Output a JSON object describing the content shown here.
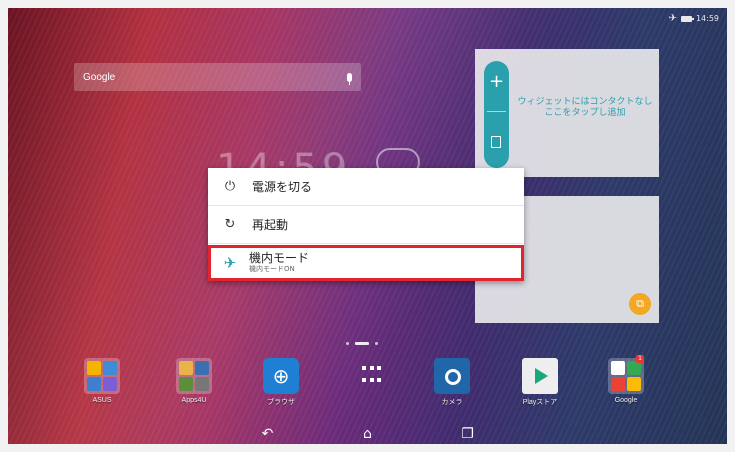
{
  "status_bar": {
    "airplane_icon": "airplane-icon",
    "battery_icon": "battery-icon",
    "time": "14:59"
  },
  "google_search": {
    "logo_text": "Google",
    "mic_icon": "mic-icon"
  },
  "clock_background_text": "14:59",
  "contact_widget": {
    "add_icon": "+",
    "hint_text": "ウィジェットにはコンタクトなし ここをタップし追加"
  },
  "power_menu": {
    "items": [
      {
        "icon": "power-icon",
        "glyph": "⏻",
        "label": "電源を切る"
      },
      {
        "icon": "restart-icon",
        "glyph": "↻",
        "label": "再起動"
      },
      {
        "icon": "airplane-icon",
        "glyph": "✈",
        "label": "機内モード",
        "sublabel": "機内モードON",
        "highlighted": true
      }
    ]
  },
  "dock": [
    {
      "label": "ASUS",
      "icon": "asus-folder-icon"
    },
    {
      "label": "Apps4U",
      "icon": "apps4u-folder-icon"
    },
    {
      "label": "ブラウザ",
      "icon": "browser-icon"
    },
    {
      "label": "",
      "icon": "all-apps-icon"
    },
    {
      "label": "カメラ",
      "icon": "camera-icon"
    },
    {
      "label": "Playストア",
      "icon": "play-store-icon"
    },
    {
      "label": "Google",
      "icon": "google-folder-icon",
      "badge": "1"
    }
  ],
  "nav_bar": {
    "back_icon": "back-icon",
    "home_icon": "home-icon",
    "recents_icon": "recents-icon"
  },
  "colors": {
    "accent": "#2aa0ad",
    "highlight_border": "#e02430",
    "memo_button": "#f2a823"
  }
}
